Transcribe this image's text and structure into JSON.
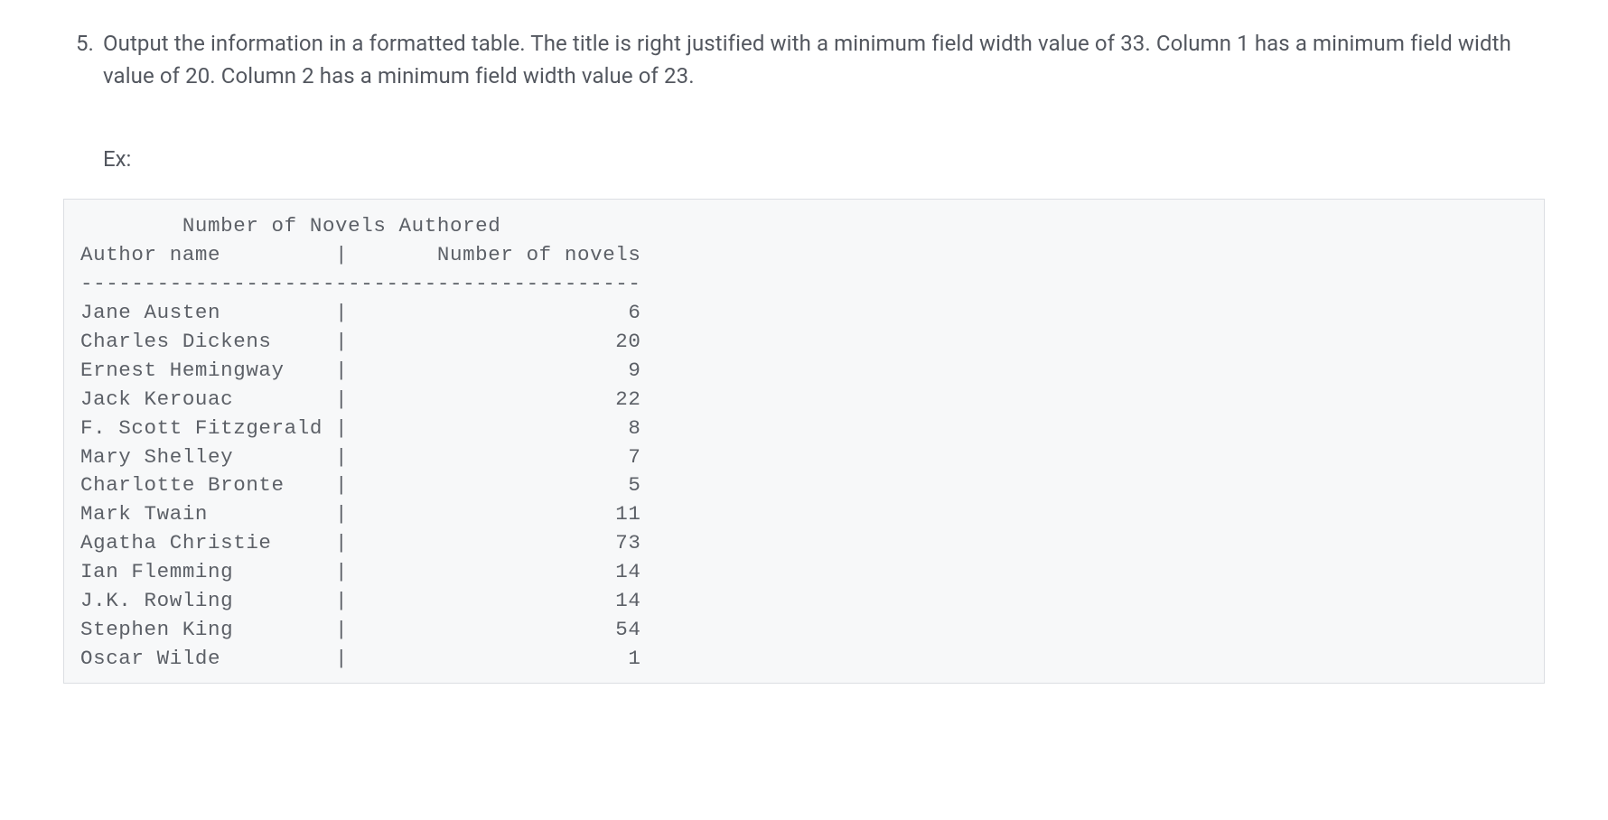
{
  "step": {
    "number": "5.",
    "text": "Output the information in a formatted table. The title is right justified with a minimum field width value of 33. Column 1 has a minimum field width value of 20. Column 2 has a minimum field width value of 23.",
    "ex_label": "Ex:"
  },
  "chart_data": {
    "type": "table",
    "title": "Number of Novels Authored",
    "title_field_width": 33,
    "col1_header": "Author name",
    "col2_header": "Number of novels",
    "col1_width": 20,
    "col2_width": 23,
    "rows": [
      {
        "author": "Jane Austen",
        "novels": 6
      },
      {
        "author": "Charles Dickens",
        "novels": 20
      },
      {
        "author": "Ernest Hemingway",
        "novels": 9
      },
      {
        "author": "Jack Kerouac",
        "novels": 22
      },
      {
        "author": "F. Scott Fitzgerald",
        "novels": 8
      },
      {
        "author": "Mary Shelley",
        "novels": 7
      },
      {
        "author": "Charlotte Bronte",
        "novels": 5
      },
      {
        "author": "Mark Twain",
        "novels": 11
      },
      {
        "author": "Agatha Christie",
        "novels": 73
      },
      {
        "author": "Ian Flemming",
        "novels": 14
      },
      {
        "author": "J.K. Rowling",
        "novels": 14
      },
      {
        "author": "Stephen King",
        "novels": 54
      },
      {
        "author": "Oscar Wilde",
        "novels": 1
      }
    ]
  }
}
